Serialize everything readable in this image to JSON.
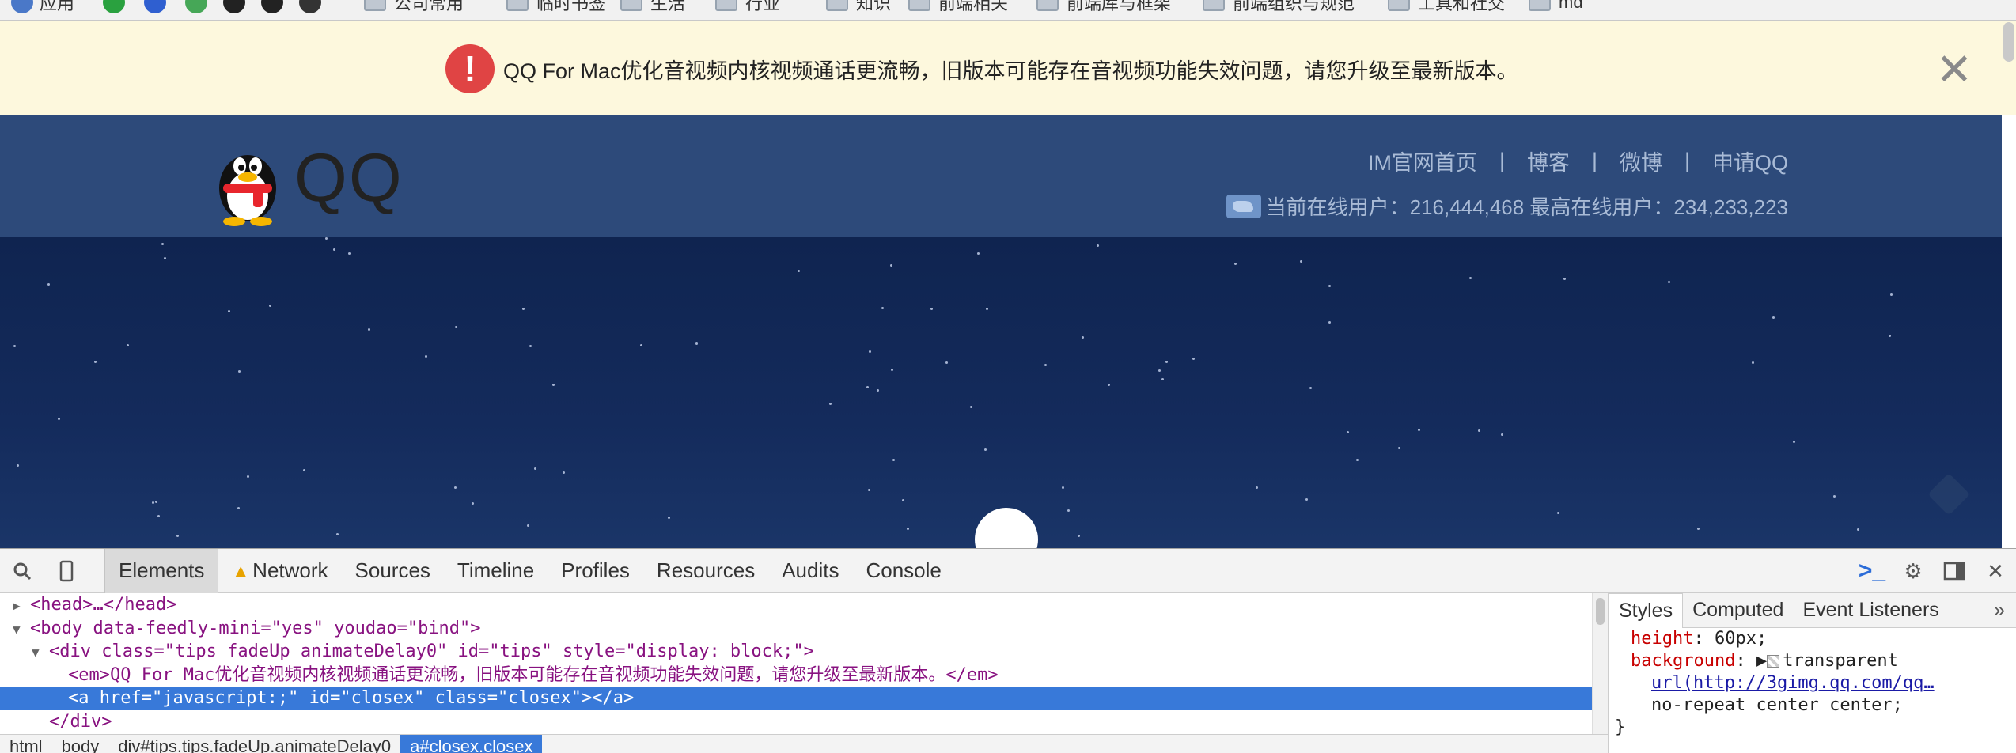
{
  "bookmarks": [
    {
      "label": "应用",
      "icon": "apps-icon"
    },
    {
      "label": "",
      "icon": "green-check-icon"
    },
    {
      "label": "",
      "icon": "blue-person-icon"
    },
    {
      "label": "",
      "icon": "chrome-icon"
    },
    {
      "label": "",
      "icon": "github-icon"
    },
    {
      "label": "",
      "icon": "github-icon"
    },
    {
      "label": "",
      "icon": "dark-circle-icon"
    },
    {
      "label": "公司常用",
      "icon": "folder-icon"
    },
    {
      "label": "临时书签",
      "icon": "folder-icon"
    },
    {
      "label": "生活",
      "icon": "folder-icon"
    },
    {
      "label": "行业",
      "icon": "folder-icon"
    },
    {
      "label": "知识",
      "icon": "folder-icon"
    },
    {
      "label": "前端相关",
      "icon": "folder-icon"
    },
    {
      "label": "前端库与框架",
      "icon": "folder-icon"
    },
    {
      "label": "前端组织与规范",
      "icon": "folder-icon"
    },
    {
      "label": "工具和社交",
      "icon": "folder-icon"
    },
    {
      "label": "md",
      "icon": "folder-icon"
    }
  ],
  "tip": {
    "text": "QQ For Mac优化音视频内核视频通话更流畅，旧版本可能存在音视频功能失效问题，请您升级至最新版本。",
    "alert_symbol": "!",
    "close_symbol": "✕"
  },
  "header": {
    "wordmark": "QQ",
    "nav": [
      "IM官网首页",
      "博客",
      "微博",
      "申请QQ"
    ],
    "separator": "|",
    "online_text": "当前在线用户：216,444,468 最高在线用户：234,233,223"
  },
  "devtools": {
    "tabs": [
      {
        "label": "Elements",
        "active": true
      },
      {
        "label": "Network",
        "active": false,
        "warning": true
      },
      {
        "label": "Sources",
        "active": false
      },
      {
        "label": "Timeline",
        "active": false
      },
      {
        "label": "Profiles",
        "active": false
      },
      {
        "label": "Resources",
        "active": false
      },
      {
        "label": "Audits",
        "active": false
      },
      {
        "label": "Console",
        "active": false
      }
    ],
    "dom_lines": [
      {
        "indent": 1,
        "tri": "▶",
        "html": "<head>…</head>"
      },
      {
        "indent": 1,
        "tri": "▼",
        "html": "<body data-feedly-mini=\"yes\" youdao=\"bind\">"
      },
      {
        "indent": 2,
        "tri": "▼",
        "html": "<div class=\"tips fadeUp animateDelay0\" id=\"tips\" style=\"display: block;\">"
      },
      {
        "indent": 3,
        "tri": "",
        "html": "<em>QQ For Mac优化音视频内核视频通话更流畅，旧版本可能存在音视频功能失效问题，请您升级至最新版本。</em>"
      },
      {
        "indent": 3,
        "tri": "",
        "html": "<a href=\"javascript:;\" id=\"closex\" class=\"closex\"></a>",
        "selected": true
      },
      {
        "indent": 2,
        "tri": "",
        "html": "</div>"
      }
    ],
    "breadcrumbs": [
      {
        "label": "html",
        "active": false
      },
      {
        "label": "body",
        "active": false
      },
      {
        "label": "div#tips.tips.fadeUp.animateDelay0",
        "active": false
      },
      {
        "label": "a#closex.closex",
        "active": true
      }
    ],
    "styles_tabs": [
      {
        "label": "Styles",
        "active": true
      },
      {
        "label": "Computed",
        "active": false
      },
      {
        "label": "Event Listeners",
        "active": false
      }
    ],
    "styles_more": "»",
    "style_lines": [
      {
        "prop": "height",
        "value": "60px;"
      },
      {
        "prop": "background",
        "value": "transparent"
      },
      {
        "prop": "",
        "value": "url(http://3gimg.qq.com/qq…"
      },
      {
        "prop": "",
        "value": "no-repeat center center;"
      },
      {
        "prop": "",
        "value": "}"
      }
    ]
  }
}
